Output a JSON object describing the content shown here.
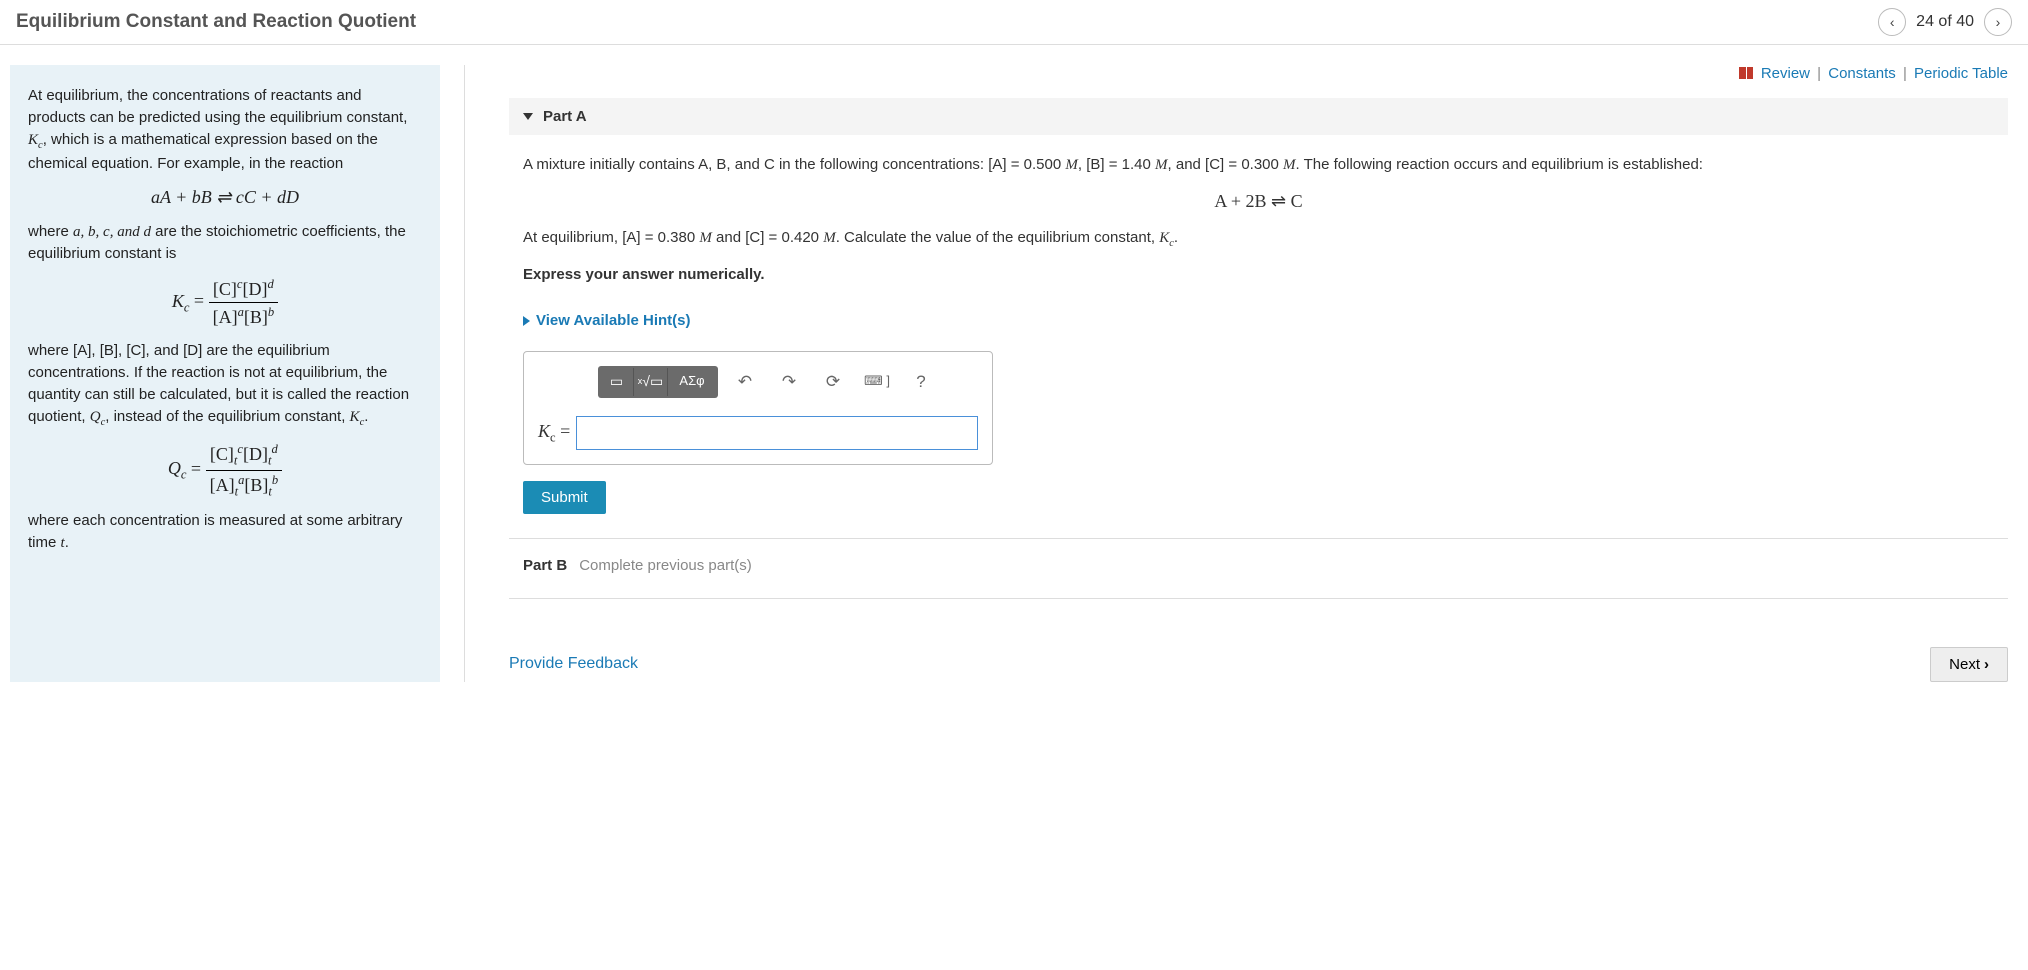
{
  "header": {
    "title": "Equilibrium Constant and Reaction Quotient",
    "position": "24 of 40"
  },
  "top_links": {
    "review": "Review",
    "constants": "Constants",
    "periodic": "Periodic Table"
  },
  "left": {
    "p1": "At equilibrium, the concentrations of reactants and products can be predicted using the equilibrium constant, ",
    "kc": "K",
    "kc_sub": "c",
    "p1b": ", which is a mathematical expression based on the chemical equation. For example, in the reaction",
    "eq1": "aA + bB ⇌ cC + dD",
    "p2a": "where ",
    "p2b": " are the stoichiometric coefficients, the equilibrium constant is",
    "coeffs": "a, b, c, and d",
    "kc_num": "[C]",
    "kc_num_sup": "c",
    "kc_num2": "[D]",
    "kc_num2_sup": "d",
    "kc_den": "[A]",
    "kc_den_sup": "a",
    "kc_den2": "[B]",
    "kc_den2_sup": "b",
    "p3": "where [A], [B], [C], and [D] are the equilibrium concentrations. If the reaction is not at equilibrium, the quantity can still be calculated, but it is called the reaction quotient, ",
    "qc": "Q",
    "p3b": ", instead of the equilibrium constant, ",
    "p3c": ".",
    "qc_num_t": "t",
    "p4": "where each concentration is measured at some arbitrary time ",
    "t": "t",
    "p4b": "."
  },
  "partA": {
    "label": "Part A",
    "q1a": "A mixture initially contains A, B, and C in the following concentrations: [A] = 0.500 ",
    "M": "M",
    "q1b": ", [B] = 1.40 ",
    "q1c": ", and [C] = 0.300 ",
    "q1d": ". The following reaction occurs and equilibrium is established:",
    "rxn": "A + 2B ⇌ C",
    "q2a": "At equilibrium, [A] = 0.380 ",
    "q2b": " and [C] = 0.420 ",
    "q2c": ". Calculate the value of the equilibrium constant, ",
    "q2d": ".",
    "express": "Express your answer numerically.",
    "hints": "View Available Hint(s)",
    "tools": {
      "template": "▭",
      "sqrt": "√▭",
      "greek": "ΑΣφ",
      "undo": "↶",
      "redo": "↷",
      "reset": "⟳",
      "keyboard": "⌨ ]",
      "help": "?"
    },
    "answer_label_k": "K",
    "answer_label_sub": "c",
    "answer_label_eq": " =",
    "submit": "Submit"
  },
  "partB": {
    "label": "Part B",
    "msg": "Complete previous part(s)"
  },
  "footer": {
    "feedback": "Provide Feedback",
    "next": "Next"
  }
}
